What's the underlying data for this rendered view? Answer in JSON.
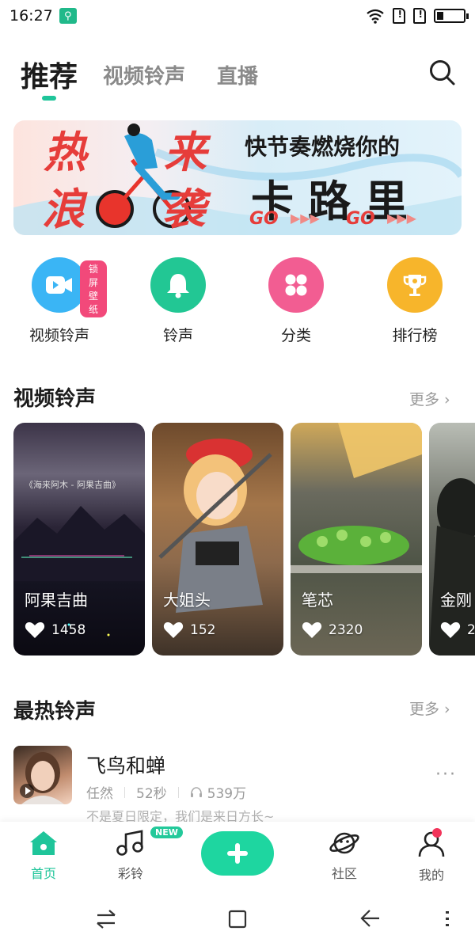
{
  "status_bar": {
    "time": "16:27"
  },
  "top_tabs": [
    {
      "label": "推荐"
    },
    {
      "label": "视频铃声"
    },
    {
      "label": "直播"
    }
  ],
  "banner": {
    "hot_line1a": "热",
    "hot_line1b": "来",
    "hot_line2a": "浪",
    "hot_line2b": "袭",
    "slogan": "快节奏燃烧你的",
    "title": "卡路里",
    "go1": "GO",
    "go2": "GO"
  },
  "quick_entries": [
    {
      "label": "视频铃声",
      "badge": "锁屏壁纸",
      "color": "#3ab5f5",
      "icon": "video-icon"
    },
    {
      "label": "铃声",
      "color": "#22c794",
      "icon": "bell-icon"
    },
    {
      "label": "分类",
      "color": "#f25d92",
      "icon": "grid-icon"
    },
    {
      "label": "排行榜",
      "color": "#f7b52b",
      "icon": "trophy-icon"
    }
  ],
  "video_section": {
    "title": "视频铃声",
    "more": "更多"
  },
  "video_cards": [
    {
      "title": "阿果吉曲",
      "likes": "1458",
      "overlay": "《海来阿木 - 阿果吉曲》"
    },
    {
      "title": "大姐头",
      "likes": "152"
    },
    {
      "title": "笔芯",
      "likes": "2320"
    },
    {
      "title": "金刚",
      "likes": "2"
    }
  ],
  "hot_section": {
    "title": "最热铃声",
    "more": "更多"
  },
  "hot_song": {
    "title": "飞鸟和蝉",
    "artist": "任然",
    "duration": "52秒",
    "plays": "539万",
    "desc": "不是夏日限定，我们是来日方长~",
    "more": "···"
  },
  "tabbar": {
    "home": "首页",
    "ring": "彩铃",
    "new_badge": "NEW",
    "community": "社区",
    "mine": "我的"
  },
  "colors": {
    "accent": "#1fc59a",
    "plus": "#1ed6a0"
  }
}
